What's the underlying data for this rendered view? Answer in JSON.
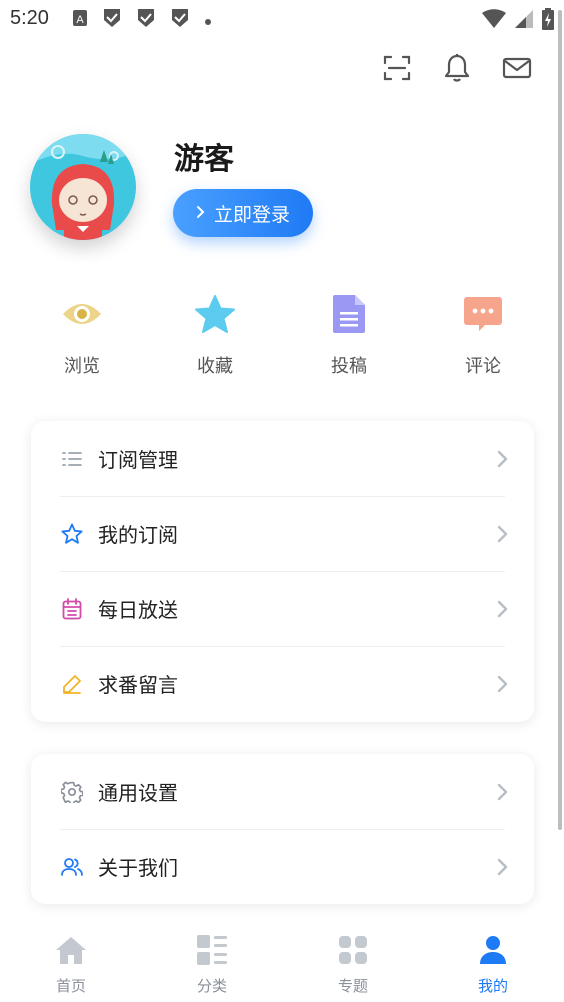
{
  "status_bar": {
    "time": "5:20",
    "left_icons": [
      "a-notification-icon",
      "shield-check-icon",
      "shield-check-icon",
      "shield-check-icon",
      "dot-icon"
    ],
    "right_icons": [
      "wifi-icon",
      "cell-signal-icon",
      "battery-icon"
    ]
  },
  "header": {
    "actions": [
      "scan-icon",
      "bell-icon",
      "mail-icon"
    ]
  },
  "profile": {
    "username": "游客",
    "login_label": "立即登录"
  },
  "quick_actions": [
    {
      "label": "浏览",
      "icon": "eye-icon",
      "color": "#e8c96a"
    },
    {
      "label": "收藏",
      "icon": "star-icon",
      "color": "#5ccbf0"
    },
    {
      "label": "投稿",
      "icon": "document-icon",
      "color": "#8f8ff0"
    },
    {
      "label": "评论",
      "icon": "comment-icon",
      "color": "#f5a08a"
    }
  ],
  "menu_group_1": [
    {
      "label": "订阅管理",
      "icon": "list-icon",
      "color": "#9aa3ad"
    },
    {
      "label": "我的订阅",
      "icon": "star-outline-icon",
      "color": "#1f7af5"
    },
    {
      "label": "每日放送",
      "icon": "calendar-icon",
      "color": "#d44aa8"
    },
    {
      "label": "求番留言",
      "icon": "pencil-icon",
      "color": "#f0b429"
    }
  ],
  "menu_group_2": [
    {
      "label": "通用设置",
      "icon": "gear-icon",
      "color": "#8a8f99"
    },
    {
      "label": "关于我们",
      "icon": "users-icon",
      "color": "#1f7af5"
    }
  ],
  "bottom_nav": [
    {
      "label": "首页",
      "icon": "home-icon",
      "active": false
    },
    {
      "label": "分类",
      "icon": "category-icon",
      "active": false
    },
    {
      "label": "专题",
      "icon": "grid-icon",
      "active": false
    },
    {
      "label": "我的",
      "icon": "person-icon",
      "active": true
    }
  ],
  "colors": {
    "accent": "#1f7af5",
    "inactive": "#c4c8cf"
  }
}
